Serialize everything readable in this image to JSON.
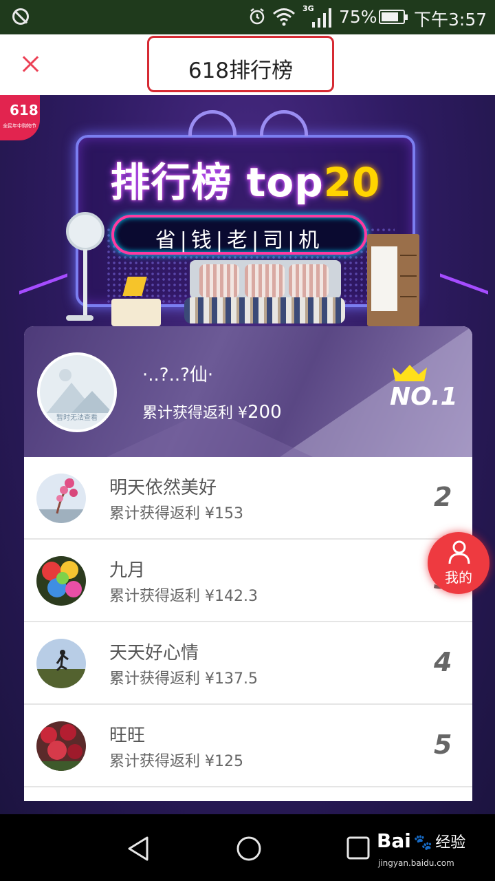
{
  "status_bar": {
    "signal_label": "3G",
    "battery_percent": "75%",
    "time": "下午3:57"
  },
  "header": {
    "title": "618排行榜",
    "close_icon": "close-icon",
    "accent": "#ec4256"
  },
  "banner": {
    "badge": "618",
    "badge_sub": "全民年中购物节",
    "headline_a": "排行榜 top",
    "headline_b": "20",
    "subtitle": "省|钱|老|司|机"
  },
  "top_rank": {
    "name": "·..?..?仙·",
    "earn_label": "累计获得返利 ¥",
    "earn_amount": "200",
    "avatar_placeholder": "暂时无法查看",
    "rank_label": "NO.1"
  },
  "rankings": [
    {
      "name": "明天依然美好",
      "earn": "累计获得返利 ¥153",
      "rank": "2"
    },
    {
      "name": "九月",
      "earn": "累计获得返利 ¥142.3",
      "rank": "3"
    },
    {
      "name": "天天好心情",
      "earn": "累计获得返利 ¥137.5",
      "rank": "4"
    },
    {
      "name": "旺旺",
      "earn": "累计获得返利 ¥125",
      "rank": "5"
    }
  ],
  "floating_button": {
    "label": "我的",
    "icon": "person-icon",
    "color": "#ee3a40"
  },
  "watermark": {
    "brand_a": "Bai",
    "brand_b": "经验",
    "url": "jingyan.baidu.com"
  }
}
